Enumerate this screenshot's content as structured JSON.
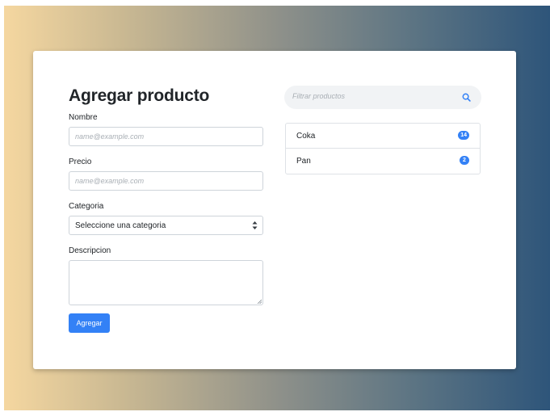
{
  "form": {
    "title": "Agregar producto",
    "nombre_label": "Nombre",
    "nombre_placeholder": "name@example.com",
    "precio_label": "Precio",
    "precio_placeholder": "name@example.com",
    "categoria_label": "Categoria",
    "categoria_selected": "Seleccione una categoria",
    "descripcion_label": "Descripcion",
    "submit_label": "Agregar"
  },
  "search": {
    "placeholder": "Filtrar productos",
    "icon": "search-icon"
  },
  "products": [
    {
      "name": "Coka",
      "count": "14"
    },
    {
      "name": "Pan",
      "count": "2"
    }
  ],
  "colors": {
    "accent": "#3381f6",
    "gradient_start": "#f5d7a0",
    "gradient_end": "#2e557a"
  }
}
